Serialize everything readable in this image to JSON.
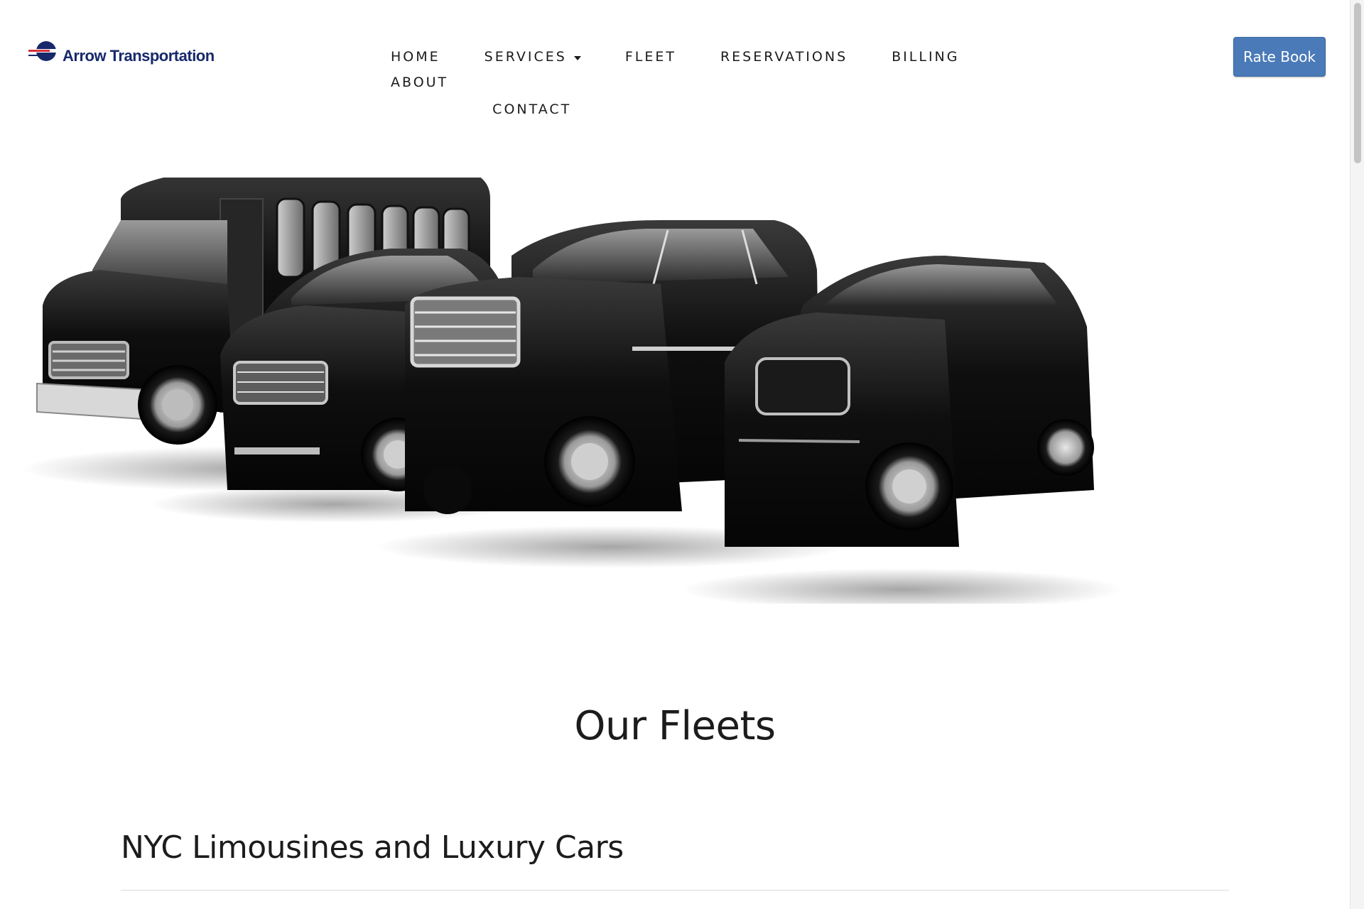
{
  "brand": {
    "name": "Arrow Transportation",
    "logo_icon": "arrow-logo-icon",
    "color": "#17296b"
  },
  "nav": {
    "items": [
      {
        "label": "HOME"
      },
      {
        "label": "SERVICES",
        "has_dropdown": true
      },
      {
        "label": "FLEET"
      },
      {
        "label": "RESERVATIONS"
      },
      {
        "label": "BILLING"
      },
      {
        "label": "ABOUT"
      },
      {
        "label": "CONTACT"
      }
    ]
  },
  "header": {
    "cta_label": "Rate Book",
    "cta_color": "#4a7ab8"
  },
  "hero": {
    "vehicles": [
      "party-bus",
      "sedan-cadillac-xts",
      "suv-cadillac-escalade",
      "sedan-chrysler-300"
    ]
  },
  "main": {
    "title": "Our Fleets",
    "section_title": "NYC Limousines and Luxury Cars"
  }
}
